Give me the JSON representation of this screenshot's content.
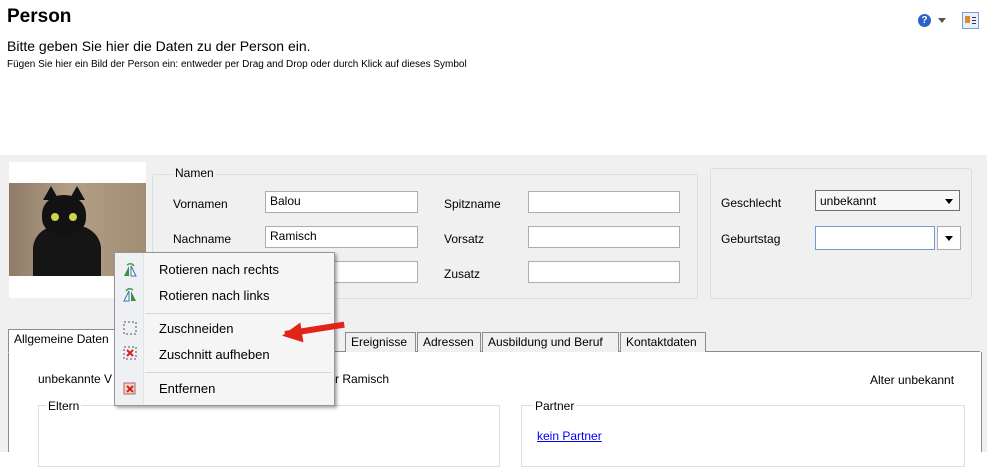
{
  "header": {
    "title": "Person",
    "subtitle": "Bitte geben Sie hier die Daten zu der Person ein.",
    "hint": "Fügen Sie hier ein Bild der Person ein: entweder per Drag and Drop oder durch Klick auf dieses Symbol",
    "help_icon_glyph": "?"
  },
  "namen": {
    "legend": "Namen",
    "vornamen_label": "Vornamen",
    "vornamen_value": "Balou",
    "nachname_label": "Nachname",
    "nachname_value": "Ramisch",
    "spitzname_label": "Spitzname",
    "spitzname_value": "",
    "vorsatz_label": "Vorsatz",
    "vorsatz_value": "",
    "zusatz_label": "Zusatz",
    "zusatz_value": ""
  },
  "details": {
    "geschlecht_label": "Geschlecht",
    "geschlecht_value": "unbekannt",
    "geburtstag_label": "Geburtstag",
    "geburtstag_value": ""
  },
  "tabs": [
    {
      "label": "Allgemeine Daten"
    },
    {
      "label": "Ereignisse"
    },
    {
      "label": "Adressen"
    },
    {
      "label": "Ausbildung und Beruf"
    },
    {
      "label": "Kontaktdaten"
    }
  ],
  "general": {
    "unknown_prefix": "unbekannte V",
    "name_suffix": "r Ramisch",
    "age": "Alter unbekannt",
    "eltern_legend": "Eltern",
    "partner_legend": "Partner",
    "partner_link": "kein Partner"
  },
  "context_menu": {
    "items": [
      {
        "label": "Rotieren nach rechts",
        "icon": "rotate-right-icon"
      },
      {
        "label": "Rotieren nach links",
        "icon": "rotate-left-icon"
      },
      {
        "label": "Zuschneiden",
        "icon": "crop-icon"
      },
      {
        "label": "Zuschnitt aufheben",
        "icon": "crop-remove-icon"
      },
      {
        "label": "Entfernen",
        "icon": "remove-picture-icon"
      }
    ]
  },
  "colors": {
    "annotation_arrow": "#e2231a",
    "link": "#0000ee"
  }
}
